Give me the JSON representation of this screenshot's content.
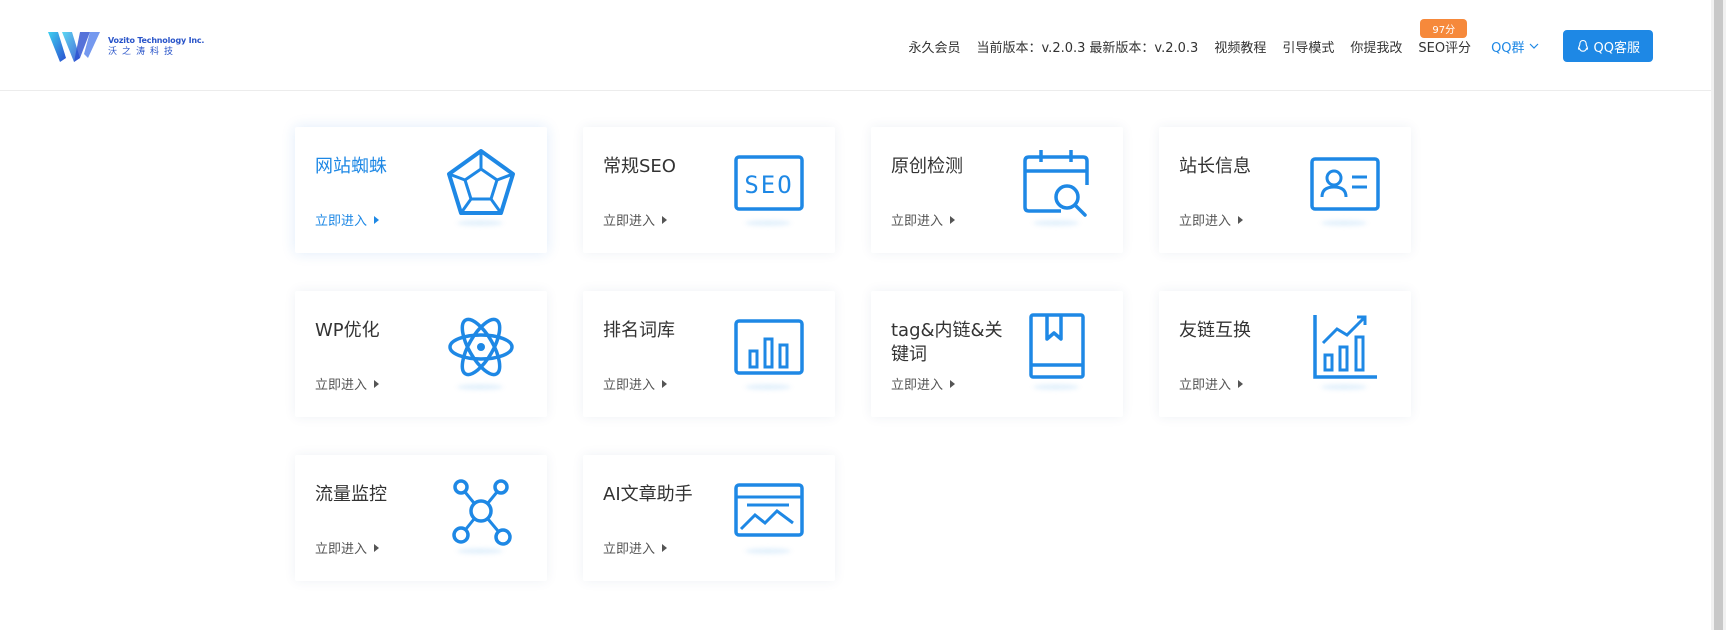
{
  "header": {
    "logo_en": "Vozito Technology Inc.",
    "logo_zh": "沃之涛科技",
    "nav": {
      "lifetime": "永久会员",
      "current_version": "当前版本：v.2.0.3",
      "latest_version": "最新版本：v.2.0.3",
      "video": "视频教程",
      "guide": "引导模式",
      "suggest": "你提我改",
      "seo_score": "SEO评分",
      "seo_badge": "97分",
      "qq_group": "QQ群",
      "qq_service": "QQ客服"
    }
  },
  "cards": [
    {
      "title": "网站蜘蛛",
      "enter": "立即进入",
      "icon": "pentagon-icon"
    },
    {
      "title": "常规SEO",
      "enter": "立即进入",
      "icon": "seo-icon"
    },
    {
      "title": "原创检测",
      "enter": "立即进入",
      "icon": "calendar-search-icon"
    },
    {
      "title": "站长信息",
      "enter": "立即进入",
      "icon": "id-card-icon"
    },
    {
      "title": "WP优化",
      "enter": "立即进入",
      "icon": "atom-icon"
    },
    {
      "title": "排名词库",
      "enter": "立即进入",
      "icon": "bar-chart-icon"
    },
    {
      "title": "tag&内链&关键词",
      "enter": "立即进入",
      "icon": "bookmark-book-icon"
    },
    {
      "title": "友链互换",
      "enter": "立即进入",
      "icon": "trend-chart-icon"
    },
    {
      "title": "流量监控",
      "enter": "立即进入",
      "icon": "network-nodes-icon"
    },
    {
      "title": "AI文章助手",
      "enter": "立即进入",
      "icon": "article-chart-icon"
    }
  ],
  "colors": {
    "accent": "#1e88e5",
    "badge": "#f6893b"
  }
}
